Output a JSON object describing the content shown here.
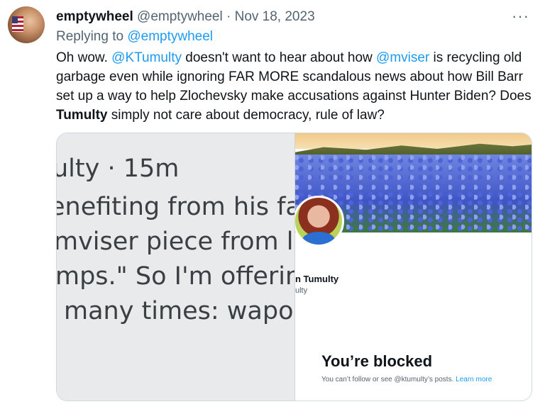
{
  "tweet": {
    "display_name": "emptywheel",
    "handle": "@emptywheel",
    "separator": "·",
    "date": "Nov 18, 2023",
    "more": "···",
    "replying_prefix": "Replying to",
    "replying_handle": "@emptywheel",
    "body": {
      "t1": "Oh wow. ",
      "m1": "@KTumulty",
      "t2": " doesn't want to hear about how ",
      "m2": "@mviser",
      "t3": " is recycling old garbage even while ignoring FAR MORE scandalous news about how Bill Barr set up a way to help Zlochevsky make accusations against Hunter Biden? Does ",
      "bold": "Tumulty",
      "t4": " simply not care about democracy, rule of law?"
    }
  },
  "media_left": {
    "lines": [
      "ulty · 15m",
      "enefiting from his fatl",
      "mviser piece from lef",
      "mps.\" So I'm offering",
      "many times: wapo.s"
    ]
  },
  "media_right": {
    "profile_name": "n Tumulty",
    "profile_handle": "ulty",
    "blocked_title": "You’re blocked",
    "blocked_msg": "You can’t follow or see @ktumulty’s posts. ",
    "learn_more": "Learn more"
  },
  "colors": {
    "link": "#1d9bf0",
    "text": "#0f1419",
    "muted": "#536471"
  }
}
